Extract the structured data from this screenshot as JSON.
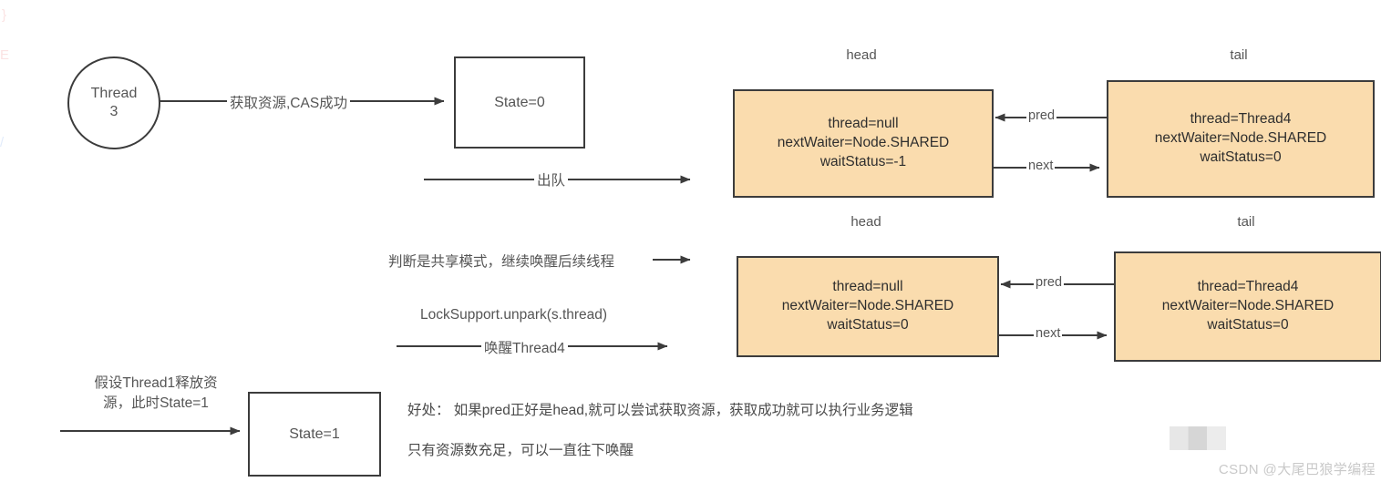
{
  "diagram": {
    "title": "AQS shared mode release and propagate",
    "colors": {
      "node_fill": "#fadcae",
      "node_border": "#3c3c3c",
      "box_border": "#3c3c3c",
      "text": "#555555",
      "arrow": "#3c3c3c"
    }
  },
  "thread_circle": {
    "line1": "Thread",
    "line2": "3"
  },
  "state_boxes": {
    "top": "State=0",
    "bottom": "State=1"
  },
  "edge_labels": {
    "acquire": "获取资源,CAS成功",
    "dequeue": "出队",
    "shared_mode": "判断是共享模式，继续唤醒后续线程",
    "unpark_call": "LockSupport.unpark(s.thread)",
    "wake_thread4": "唤醒Thread4"
  },
  "release_note": {
    "line1": "假设Thread1释放资",
    "line2": "源，此时State=1"
  },
  "queue_rows": [
    {
      "head_label": "head",
      "tail_label": "tail",
      "head_node": {
        "thread": "thread=null",
        "next_waiter": "nextWaiter=Node.SHARED",
        "wait_status": "waitStatus=-1"
      },
      "tail_node": {
        "thread": "thread=Thread4",
        "next_waiter": "nextWaiter=Node.SHARED",
        "wait_status": "waitStatus=0"
      },
      "pred_label": "pred",
      "next_label": "next"
    },
    {
      "head_label": "head",
      "tail_label": "tail",
      "head_node": {
        "thread": "thread=null",
        "next_waiter": "nextWaiter=Node.SHARED",
        "wait_status": "waitStatus=0"
      },
      "tail_node": {
        "thread": "thread=Thread4",
        "next_waiter": "nextWaiter=Node.SHARED",
        "wait_status": "waitStatus=0"
      },
      "pred_label": "pred",
      "next_label": "next"
    }
  ],
  "notes": {
    "benefit": "好处：  如果pred正好是head,就可以尝试获取资源，获取成功就可以执行业务逻辑",
    "condition": "只有资源数充足，可以一直往下唤醒"
  },
  "watermark": {
    "text": "CSDN @大尾巴狼学编程"
  }
}
